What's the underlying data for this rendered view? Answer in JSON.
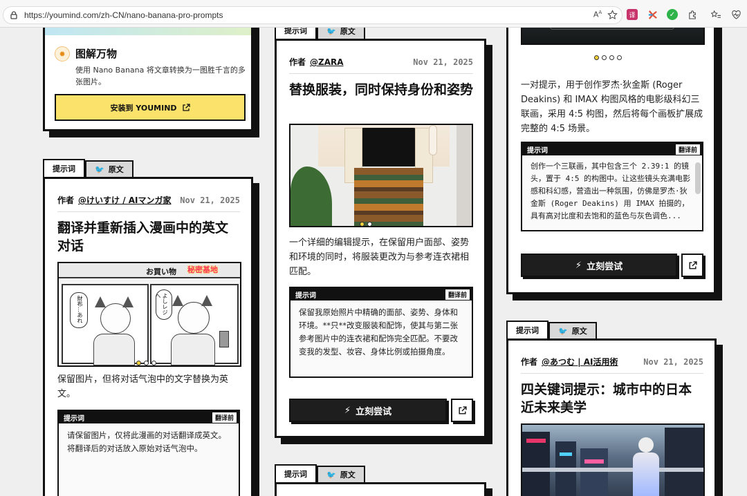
{
  "browser": {
    "url": "https://youmind.com/zh-CN/nano-banana-pro-prompts"
  },
  "common": {
    "tab_prompt": "提示词",
    "tab_original": "原文",
    "author_label": "作者",
    "prompt_head": "提示词",
    "translate_badge": "翻译前",
    "try_label": "立刻尝试"
  },
  "promo": {
    "title": "图解万物",
    "desc": "使用 Nano Banana 将文章转换为一图胜千言的多张图片。",
    "install_label": "安装到 YOUMIND"
  },
  "card1": {
    "author": "@けいすけ / AIマンガ家",
    "date": "Nov 21, 2025",
    "title": "翻译并重新插入漫画中的英文对话",
    "image_texts": [
      "お買い物",
      "秘密基地",
      "財布…あれ",
      "よしレジへ"
    ],
    "desc": "保留图片，但将对话气泡中的文字替换为英文。",
    "prompt": "请保留图片，仅将此漫画的对话翻译成英文。将翻译后的对话放入原始对话气泡中。"
  },
  "card2": {
    "author": "@ZARA",
    "date": "Nov 21, 2025",
    "title": "替换服装，同时保持身份和姿势",
    "desc": "一个详细的编辑提示，在保留用户面部、姿势和环境的同时，将服装更改为与参考连衣裙相匹配。",
    "prompt": "保留我原始照片中精确的面部、姿势、身体和环境。**只**改变服装和配饰，使其与第二张参考图片中的连衣裙和配饰完全匹配。不要改变我的发型、妆容、身体比例或拍摄角度。"
  },
  "card3": {
    "desc": "一对提示，用于创作罗杰·狄金斯 (Roger Deakins) 和 IMAX 构图风格的电影级科幻三联画，采用 4:5 构图，然后将每个画板扩展成完整的 4:5 场景。",
    "prompt": "创作一个三联画，其中包含三个 2.39:1 的镜头，置于 4:5 的构图中。让这些镜头充满电影感和科幻感，营造出一种氛围，仿佛是罗杰·狄金斯 (Roger Deakins) 用 IMAX 拍摄的，具有高对比度和去饱和的蓝色与灰色调色..."
  },
  "card4": {
    "author": "@あつむ | AI活用術",
    "date": "Nov 21, 2025",
    "title": "四关键词提示：城市中的日本近未来美学"
  },
  "colors": {
    "accent_yellow": "#fbe36b",
    "ink": "#111111",
    "button_dark": "#1e1e1e"
  }
}
